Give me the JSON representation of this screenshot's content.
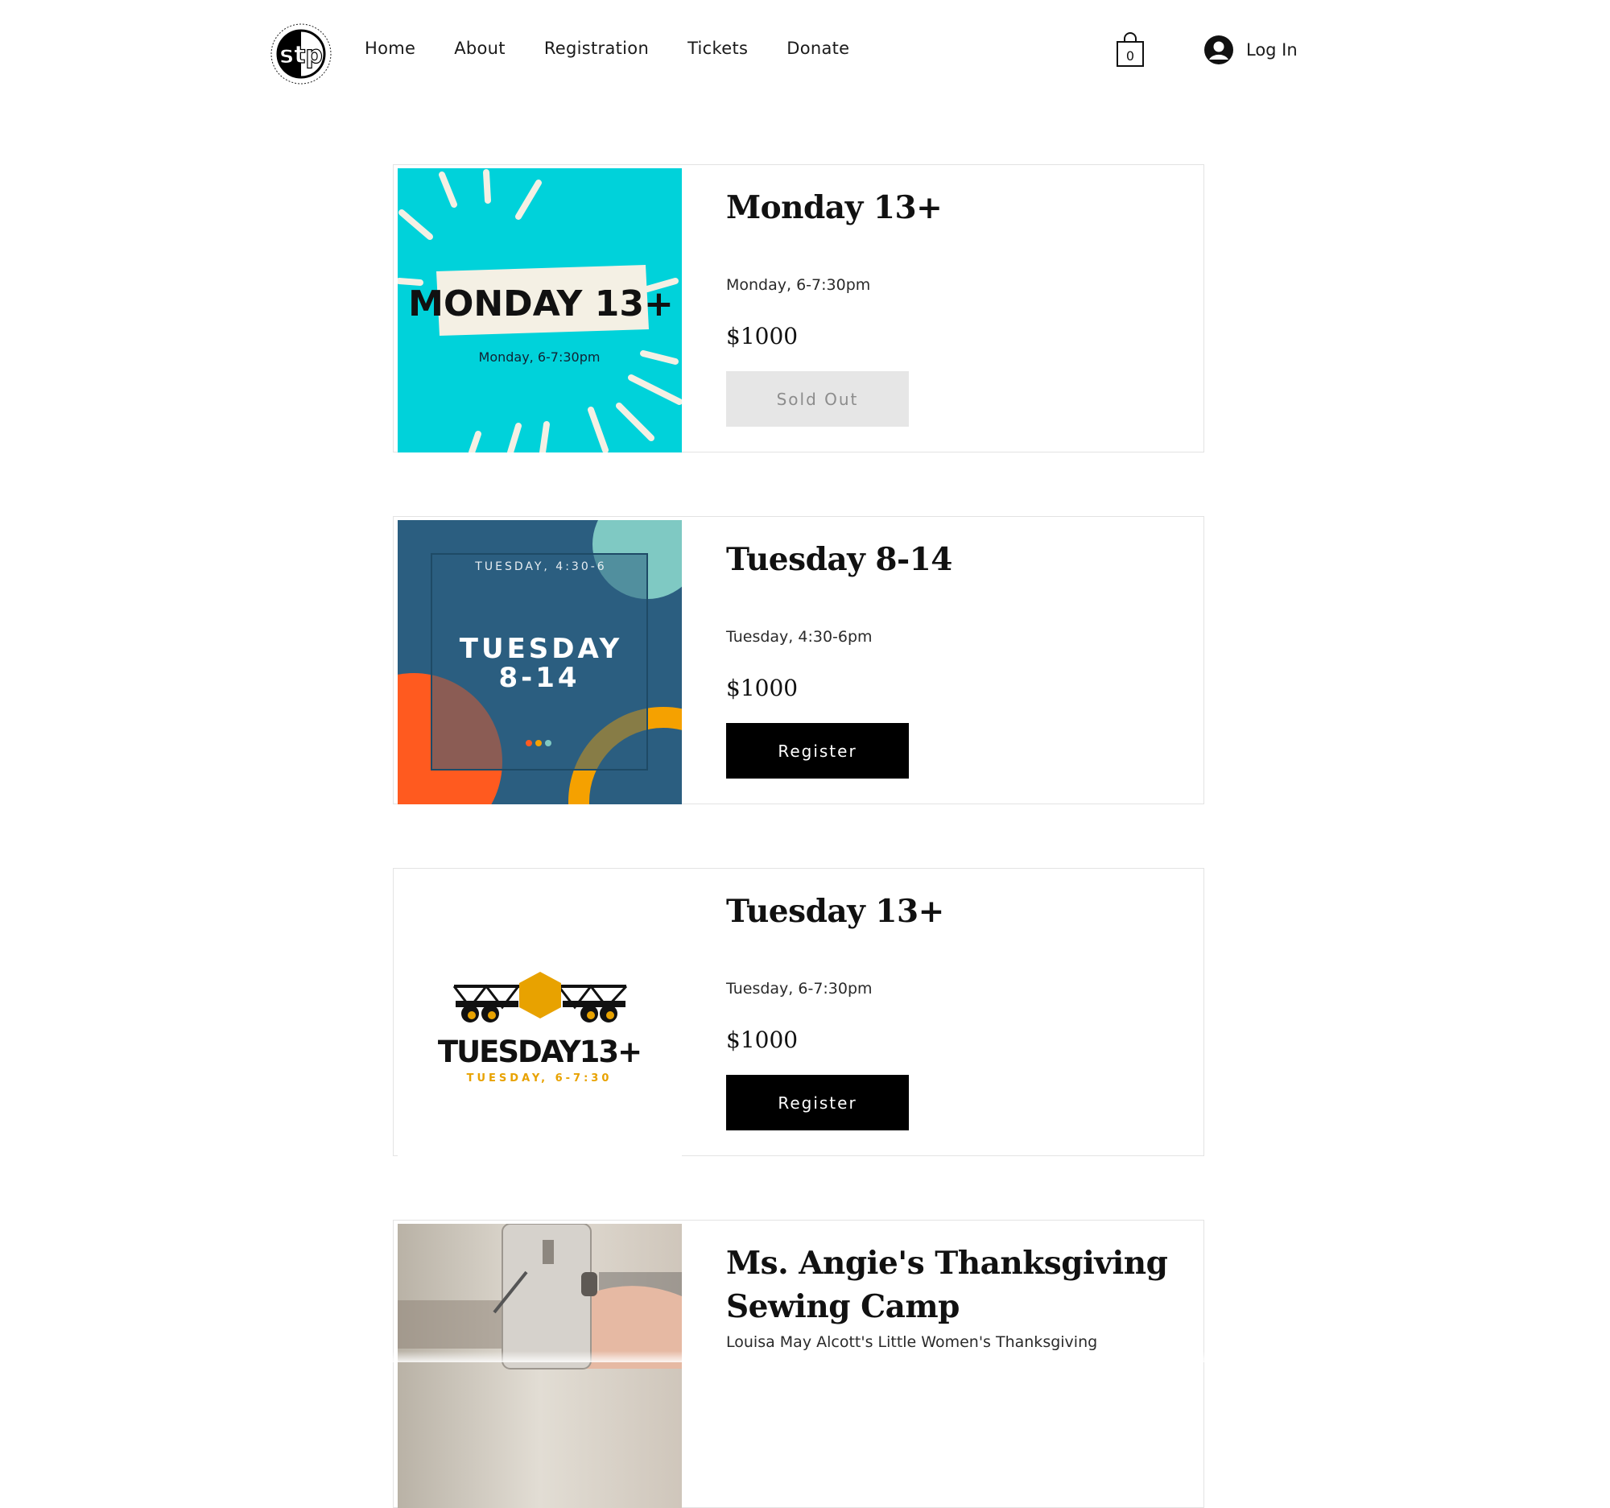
{
  "header": {
    "logo_text": "stp",
    "nav": [
      "Home",
      "About",
      "Registration",
      "Tickets",
      "Donate"
    ],
    "cart_count": "0",
    "login_label": "Log In"
  },
  "classes": [
    {
      "title": "Monday 13+",
      "time": "Monday, 6-7:30pm",
      "price": "$1000",
      "button": "Sold Out",
      "image": {
        "headline": "MONDAY 13+",
        "subline": "Monday, 6-7:30pm",
        "bg": "#00d2da"
      }
    },
    {
      "title": "Tuesday 8-14",
      "time": "Tuesday, 4:30-6pm",
      "price": "$1000",
      "button": "Register",
      "image": {
        "topline": "TUESDAY, 4:30-6",
        "headline1": "TUESDAY",
        "headline2": "8-14",
        "bg": "#2b5e80"
      }
    },
    {
      "title": "Tuesday 13+",
      "time": "Tuesday, 6-7:30pm",
      "price": "$1000",
      "button": "Register",
      "image": {
        "headline": "TUESDAY13+",
        "subline": "TUESDAY, 6-7:30",
        "accent": "#e8a200"
      }
    },
    {
      "title_line1": "Ms. Angie's Thanksgiving",
      "title_line2": "Sewing Camp",
      "description": "Louisa May Alcott's Little Women's Thanksgiving"
    }
  ]
}
